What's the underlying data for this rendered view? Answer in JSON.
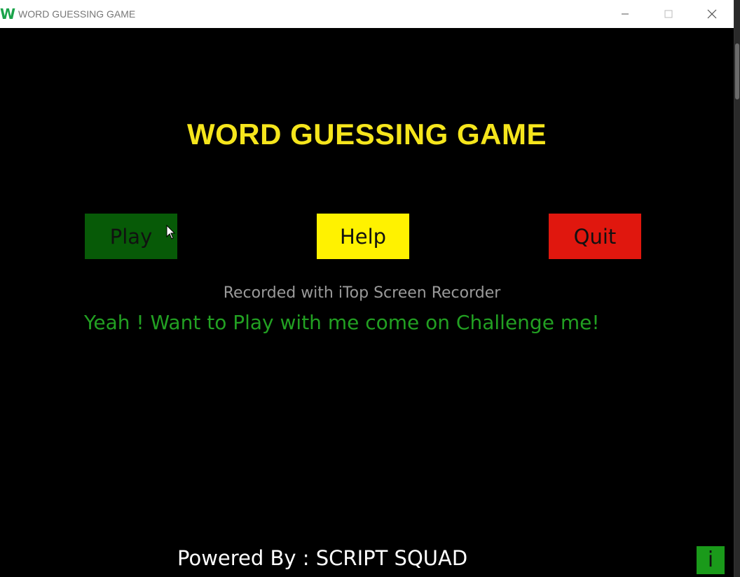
{
  "window": {
    "app_icon_letter": "W",
    "title": "WORD GUESSING GAME",
    "controls": [
      "minimize-icon",
      "maximize-icon",
      "close-icon"
    ]
  },
  "game": {
    "title": "WORD GUESSING GAME",
    "buttons": [
      {
        "label": "Play",
        "color": "#075a07"
      },
      {
        "label": "Help",
        "color": "#fff200"
      },
      {
        "label": "Quit",
        "color": "#e0170e"
      }
    ],
    "watermark": "Recorded with iTop Screen Recorder",
    "challenge_text": "Yeah ! Want to Play with me come on Challenge me!",
    "powered_by": "Powered By : SCRIPT SQUAD",
    "info_button": {
      "label": "i",
      "color": "#1a9a1a"
    }
  },
  "colors": {
    "background": "#000000",
    "title": "#f5e51c",
    "challenge": "#22a022",
    "powered": "#ffffff"
  }
}
